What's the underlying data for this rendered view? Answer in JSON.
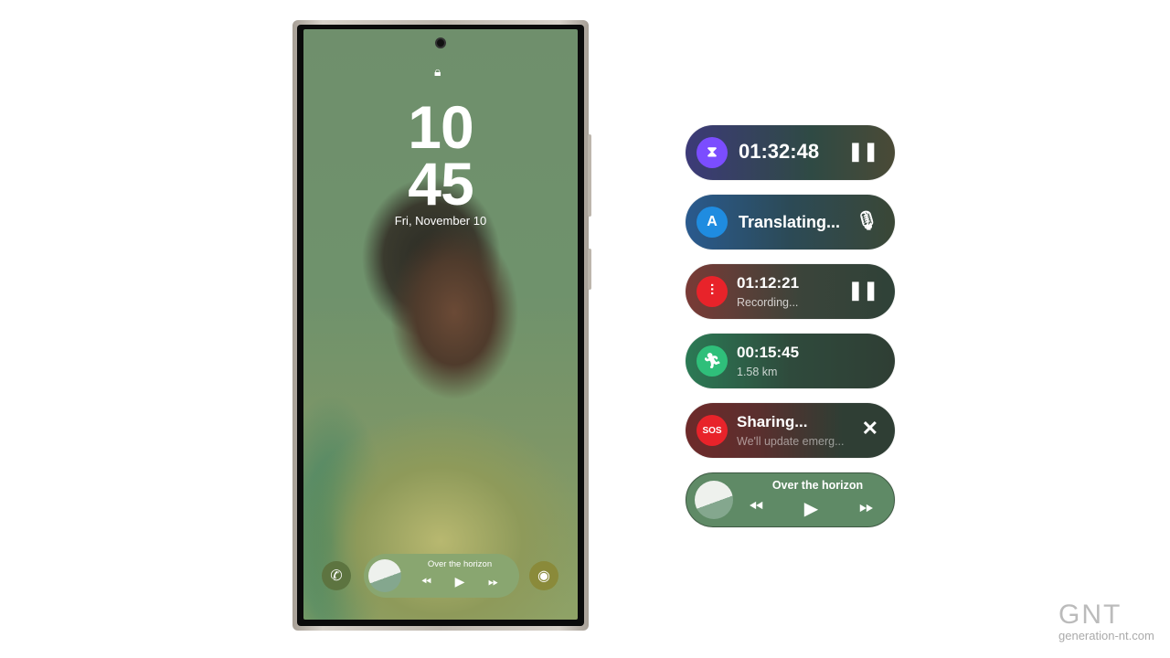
{
  "lockscreen": {
    "hour": "10",
    "minute": "45",
    "date": "Fri, November 10",
    "media": {
      "title": "Over the horizon",
      "album_art_text": "OVER THE HORIZON"
    },
    "left_shortcut": "phone-icon",
    "right_shortcut": "camera-icon"
  },
  "now_bar": [
    {
      "type": "timer",
      "title": "01:32:48",
      "icon": "hourglass-icon",
      "action": "pause-icon",
      "icon_color": "#7b4dff"
    },
    {
      "type": "translate",
      "title": "Translating...",
      "icon": "translate-icon",
      "action": "microphone-icon",
      "icon_color": "#1f8ce0"
    },
    {
      "type": "recording",
      "title": "01:12:21",
      "subtitle": "Recording...",
      "icon": "waveform-icon",
      "action": "pause-icon",
      "icon_color": "#e8232a"
    },
    {
      "type": "exercise",
      "title": "00:15:45",
      "subtitle": "1.58 km",
      "icon": "running-icon",
      "action": "",
      "icon_color": "#2fbf7a"
    },
    {
      "type": "sos",
      "title": "Sharing...",
      "subtitle": "We'll update emerg...",
      "icon": "sos-icon",
      "action": "close-icon",
      "icon_color": "#e8232a"
    },
    {
      "type": "media",
      "title": "Over the horizon",
      "album_art_text": "OVER THE HORIZON"
    }
  ],
  "watermark": {
    "brand": "GNT",
    "site": "generation-nt.com"
  }
}
